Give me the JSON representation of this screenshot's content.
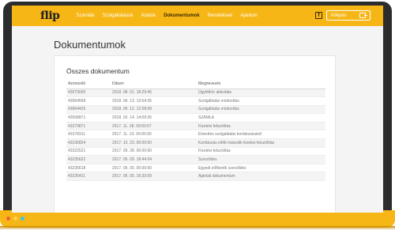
{
  "header": {
    "logo": "flip",
    "nav": [
      "Számlák",
      "Szolgáltatások",
      "Adatok",
      "Dokumentumok",
      "Rendelések",
      "Ajánlom"
    ],
    "active_nav": "Dokumentumok",
    "facebook_glyph": "f",
    "logout_label": "Kilépés"
  },
  "page": {
    "title": "Dokumentumok"
  },
  "documents": {
    "title": "Összes dokumentum",
    "columns": [
      "Azonosító",
      "Dátum",
      "Megnevezés"
    ],
    "rows": [
      [
        "43979090",
        "2018. 08. 01. 18:29:45",
        "Ügyfélkör aktiválás"
      ],
      [
        "43964568",
        "2018. 06. 13. 13:54:35",
        "Szolgáltatás módosítás"
      ],
      [
        "43964425",
        "2018. 06. 12. 12:28:08",
        "Szolgáltatás módosítás"
      ],
      [
        "43508871",
        "2018. 03. 14. 14:09:35",
        "SZÁMLA"
      ],
      [
        "43379871",
        "2017. 11. 28. 09:00:07",
        "Fizetési felszólítás"
      ],
      [
        "43378311",
        "2017. 11. 23. 00:00:00",
        "Értesítés szolgáltatás korlátozásáról"
      ],
      [
        "43236824",
        "2017. 10. 23. 00:00:00",
        "Korlátozás előtti második fizetési felszólítás"
      ],
      [
        "43322521",
        "2017. 09. 28. 00:00:00",
        "Fizetési felszólítás"
      ],
      [
        "43235622",
        "2017. 05. 09. 18:44:04",
        "Szerződés"
      ],
      [
        "43235618",
        "2017. 05. 09. 00:00:00",
        "Egyedi előfizetői szerződés"
      ],
      [
        "43235411",
        "2017. 05. 05. 16:33:09",
        "Ajánlati dokumentum"
      ]
    ]
  },
  "colors": {
    "brand": "#f6b615",
    "frame": "#2c2c2e",
    "dot_red": "#f2623b",
    "dot_yellow": "#ffd24a",
    "dot_blue": "#3cc4f0"
  }
}
